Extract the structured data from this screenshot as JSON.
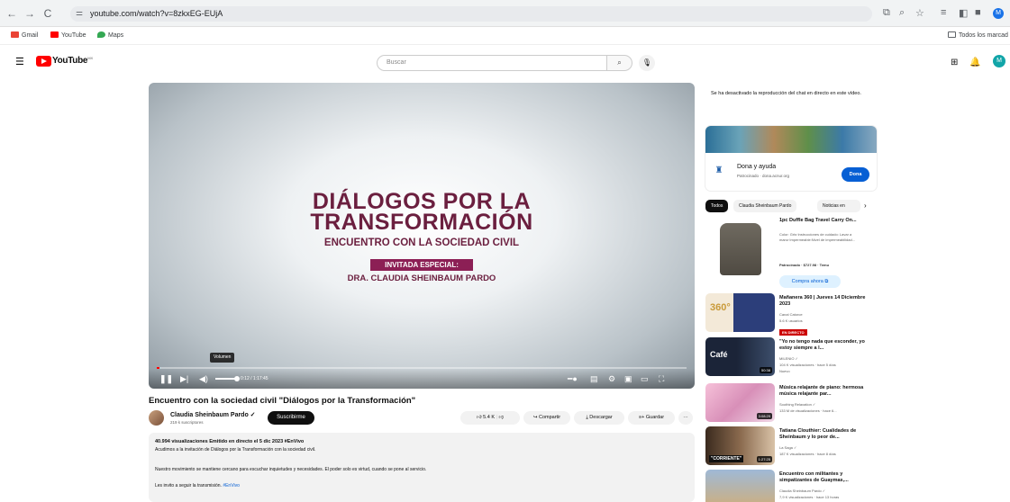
{
  "browser": {
    "url": "youtube.com/watch?v=8zkxEG-EUjA",
    "bookmarks": [
      "Gmail",
      "YouTube",
      "Maps"
    ],
    "all_bookmarks": "Todos los marcad",
    "profile_initial": "M"
  },
  "header": {
    "logo_text": "YouTube",
    "logo_country": "MX",
    "search_placeholder": "Buscar",
    "avatar_initial": "M"
  },
  "player": {
    "title_line1": "DIÁLOGOS POR LA",
    "title_line2": "TRANSFORMACIÓN",
    "subtitle": "ENCUENTRO CON LA SOCIEDAD CIVIL",
    "badge": "INVITADA ESPECIAL:",
    "guest": "DRA. CLAUDIA SHEINBAUM PARDO",
    "tooltip": "Volumen",
    "time": "0:12 / 1:17:45",
    "progress": 0.003,
    "volume": 1.0
  },
  "video": {
    "title": "Encuentro con la sociedad civil \"Diálogos por la Transformación\"",
    "channel": "Claudia Sheinbaum Pardo ✓",
    "subscribers": "219 k suscriptores",
    "subscribe": "Suscribirme",
    "likes": "5.4 K",
    "share": "Compartir",
    "download": "Descargar",
    "save": "Guardar",
    "more": "···"
  },
  "description": {
    "meta": "40.994 visualizaciones  Emitido en directo el 5 dic 2023  #EnVivo",
    "line1": "Acudimos a la invitación de Diálogos por la Transformación con la sociedad civil.",
    "line2": "Nuestro movimiento se mantiene cercano para escuchar inquietudes y necesidades. El poder solo es virtud, cuando se pone al servicio.",
    "line3_text": "Les invito a seguir la transmisión. ",
    "line3_hash": "#EnVivo"
  },
  "sidebar": {
    "chat_note": "Se ha desactivado la reproducción del chat en directo en este vídeo.",
    "ad": {
      "title": "Dona y ayuda",
      "sponsor": "Patrocinado · dona.acnur.org",
      "button": "Dona"
    },
    "chips": [
      "Todos",
      "Claudia Sheinbaum Pardo",
      "Noticias en"
    ],
    "recs": [
      {
        "title": "1pc Duffle Bag Travel Carry On...",
        "meta": "Color: Gris·Instrucciones de cuidado: Lavar a mano·Impermeable:Nivel de impermeabilidad...",
        "extra": "Patrocinado · $727.98 · Temu",
        "button": "Compra ahora"
      },
      {
        "title": "Mañanera 360 | Jueves 14 Diciembre 2023",
        "meta": "Canal Catorce",
        "extra": "5.6 K usuarios",
        "badge": "EN DIRECTO"
      },
      {
        "title": "\"Yo no tengo nada que esconder, yo estoy siempre a l...",
        "meta": "MILENIO ✓",
        "extra": "104 K visualizaciones · hace 5 días",
        "tag": "Nuevo",
        "duration": "50:38"
      },
      {
        "title": "Música relajante de piano: hermosa música relajante par...",
        "meta": "Soothing Relaxation ✓",
        "extra": "133 M de visualizaciones · hace 6...",
        "duration": "3:08:29"
      },
      {
        "title": "Tatiana Clouthier: Cualidades de Sheinbaum y lo peor de...",
        "meta": "La Saga ✓",
        "extra": "187 K visualizaciones · hace 8 días",
        "duration": "1:27:25"
      },
      {
        "title": "Encuentro con militantes y simpatizantes de Guaymas,...",
        "meta": "Claudia Sheinbaum Pardo ✓",
        "extra": "7,9 K visualizaciones · hace 13 horas"
      }
    ]
  }
}
